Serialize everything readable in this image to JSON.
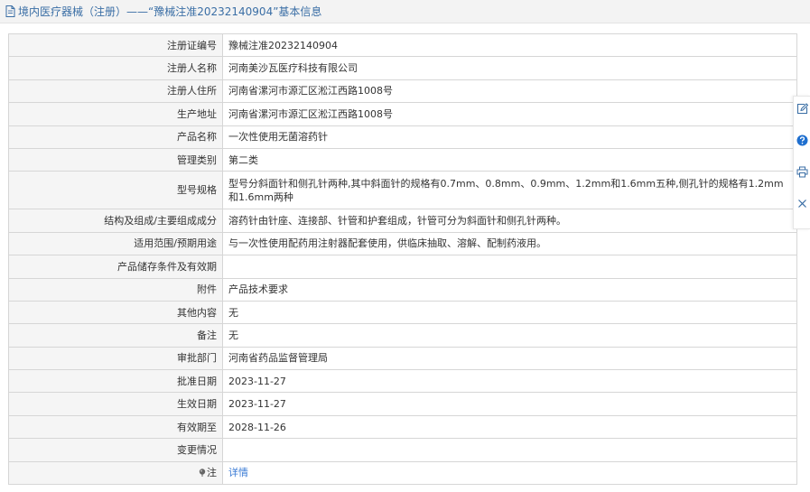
{
  "header": {
    "title": "境内医疗器械（注册）——“豫械注准20232140904”基本信息"
  },
  "rows": [
    {
      "label": "注册证编号",
      "value": "豫械注准20232140904"
    },
    {
      "label": "注册人名称",
      "value": "河南美沙瓦医疗科技有限公司"
    },
    {
      "label": "注册人住所",
      "value": "河南省漯河市源汇区淞江西路1008号"
    },
    {
      "label": "生产地址",
      "value": "河南省漯河市源汇区淞江西路1008号"
    },
    {
      "label": "产品名称",
      "value": "一次性使用无菌溶药针"
    },
    {
      "label": "管理类别",
      "value": "第二类"
    },
    {
      "label": "型号规格",
      "value": "型号分斜面针和侧孔针两种,其中斜面针的规格有0.7mm、0.8mm、0.9mm、1.2mm和1.6mm五种,侧孔针的规格有1.2mm和1.6mm两种"
    },
    {
      "label": "结构及组成/主要组成成分",
      "value": "溶药针由针座、连接部、针管和护套组成，针管可分为斜面针和侧孔针两种。"
    },
    {
      "label": "适用范围/预期用途",
      "value": "与一次性使用配药用注射器配套使用，供临床抽取、溶解、配制药液用。"
    },
    {
      "label": "产品储存条件及有效期",
      "value": ""
    },
    {
      "label": "附件",
      "value": "产品技术要求"
    },
    {
      "label": "其他内容",
      "value": "无"
    },
    {
      "label": "备注",
      "value": "无"
    },
    {
      "label": "审批部门",
      "value": "河南省药品监督管理局"
    },
    {
      "label": "批准日期",
      "value": "2023-11-27"
    },
    {
      "label": "生效日期",
      "value": "2023-11-27"
    },
    {
      "label": "有效期至",
      "value": "2028-11-26"
    },
    {
      "label": "变更情况",
      "value": ""
    },
    {
      "label": "注",
      "value": "详情"
    }
  ],
  "icons": {
    "header": "document-icon",
    "note": "pin-icon",
    "sidebar": [
      "edit-icon",
      "help-icon",
      "print-icon",
      "close-icon"
    ]
  },
  "colors": {
    "link": "#3a7bd5",
    "header_text": "#3a6ea5",
    "help_icon": "#1f6fcf"
  }
}
